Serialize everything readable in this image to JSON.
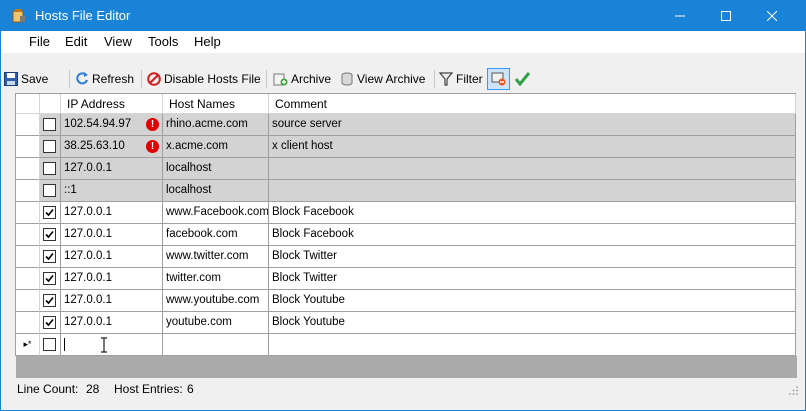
{
  "window": {
    "title": "Hosts File Editor",
    "accent_color": "#1883d7"
  },
  "menu": [
    "File",
    "Edit",
    "View",
    "Tools",
    "Help"
  ],
  "toolbar": {
    "save_label": "Save",
    "refresh_label": "Refresh",
    "disable_label": "Disable Hosts File",
    "archive_label": "Archive",
    "view_archive_label": "View Archive",
    "filter_label": "Filter"
  },
  "grid": {
    "columns": [
      "IP Address",
      "Host Names",
      "Comment"
    ],
    "rows": [
      {
        "checked": false,
        "ip": "102.54.94.97",
        "host": "rhino.acme.com",
        "comment": "source server",
        "warning": true,
        "disabled": true
      },
      {
        "checked": false,
        "ip": "38.25.63.10",
        "host": "x.acme.com",
        "comment": "x client host",
        "warning": true,
        "disabled": true
      },
      {
        "checked": false,
        "ip": "127.0.0.1",
        "host": "localhost",
        "comment": "",
        "warning": false,
        "disabled": true
      },
      {
        "checked": false,
        "ip": "::1",
        "host": "localhost",
        "comment": "",
        "warning": false,
        "disabled": true
      },
      {
        "checked": true,
        "ip": "127.0.0.1",
        "host": "www.Facebook.com",
        "comment": "Block Facebook",
        "warning": false,
        "disabled": false
      },
      {
        "checked": true,
        "ip": "127.0.0.1",
        "host": "facebook.com",
        "comment": "Block Facebook",
        "warning": false,
        "disabled": false
      },
      {
        "checked": true,
        "ip": "127.0.0.1",
        "host": "www.twitter.com",
        "comment": "Block Twitter",
        "warning": false,
        "disabled": false
      },
      {
        "checked": true,
        "ip": "127.0.0.1",
        "host": "twitter.com",
        "comment": "Block Twitter",
        "warning": false,
        "disabled": false
      },
      {
        "checked": true,
        "ip": "127.0.0.1",
        "host": "www.youtube.com",
        "comment": "Block Youtube",
        "warning": false,
        "disabled": false
      },
      {
        "checked": true,
        "ip": "127.0.0.1",
        "host": "youtube.com",
        "comment": "Block Youtube",
        "warning": false,
        "disabled": false
      }
    ],
    "new_row_marker": "▸*"
  },
  "status": {
    "line_count_label": "Line Count:",
    "line_count": "28",
    "host_entries_label": "Host Entries:",
    "host_entries": "6"
  }
}
